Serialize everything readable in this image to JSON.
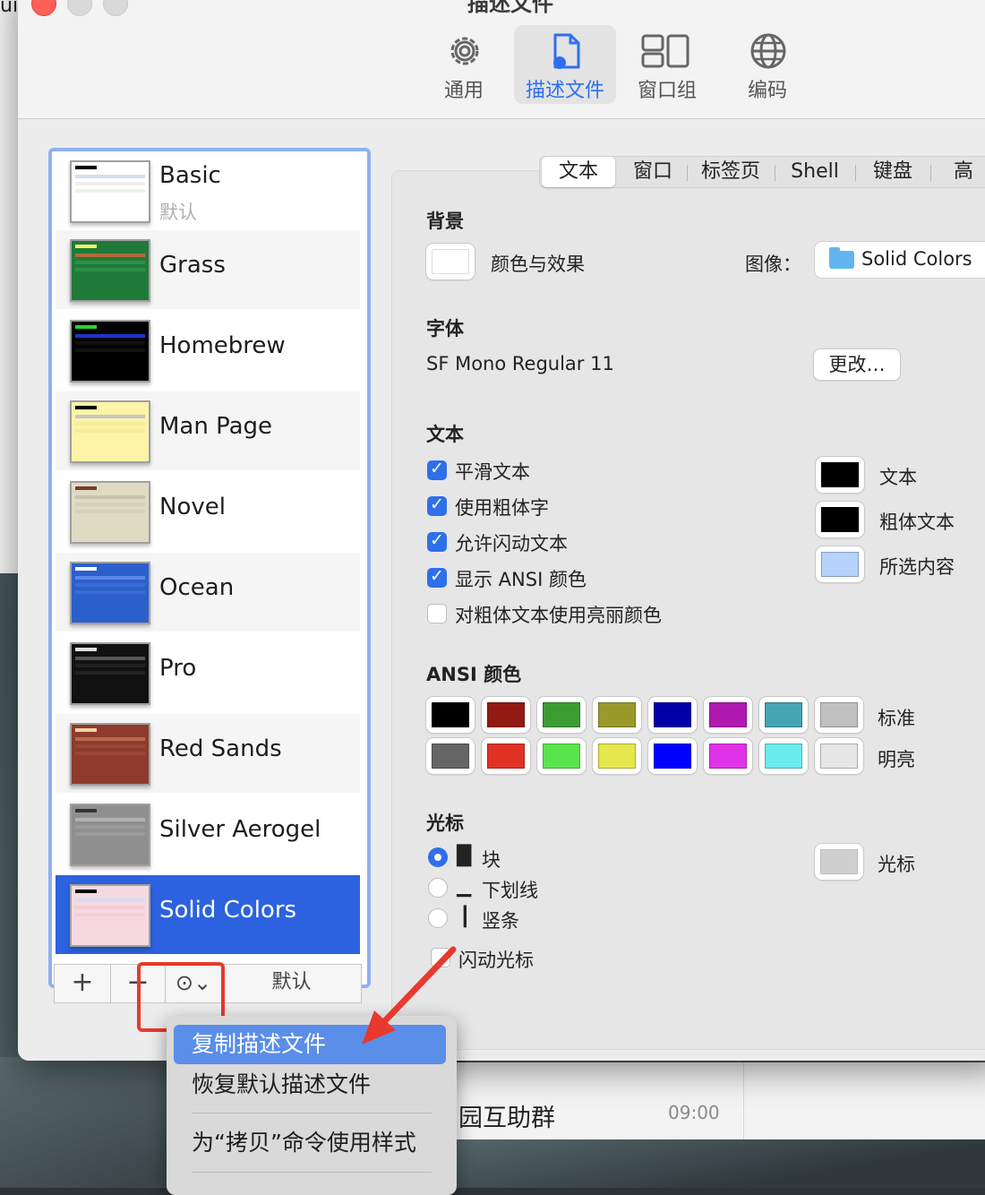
{
  "window": {
    "title": "描述文件"
  },
  "toolbar": {
    "items": [
      {
        "label": "通用",
        "icon": "gear-icon"
      },
      {
        "label": "描述文件",
        "icon": "profile-document-icon"
      },
      {
        "label": "窗口组",
        "icon": "window-groups-icon"
      },
      {
        "label": "编码",
        "icon": "globe-icon"
      }
    ],
    "active_index": 1
  },
  "profiles": [
    {
      "name": "Basic",
      "subtitle": "默认"
    },
    {
      "name": "Grass"
    },
    {
      "name": "Homebrew"
    },
    {
      "name": "Man Page"
    },
    {
      "name": "Novel"
    },
    {
      "name": "Ocean"
    },
    {
      "name": "Pro"
    },
    {
      "name": "Red Sands"
    },
    {
      "name": "Silver Aerogel"
    },
    {
      "name": "Solid Colors"
    }
  ],
  "selected_profile": "Solid Colors",
  "list_buttons": {
    "add": "+",
    "remove": "−",
    "more": "⊙⌄",
    "default": "默认"
  },
  "tabs": [
    "文本",
    "窗口",
    "标签页",
    "Shell",
    "键盘",
    "高"
  ],
  "active_tab": "文本",
  "background": {
    "heading": "背景",
    "color_effects_label": "颜色与效果",
    "image_label": "图像：",
    "image_value": "Solid Colors"
  },
  "font": {
    "heading": "字体",
    "value": "SF Mono Regular 11",
    "change_button": "更改…"
  },
  "text": {
    "heading": "文本",
    "checkboxes": [
      {
        "label": "平滑文本",
        "checked": true
      },
      {
        "label": "使用粗体字",
        "checked": true
      },
      {
        "label": "允许闪动文本",
        "checked": true
      },
      {
        "label": "显示 ANSI 颜色",
        "checked": true
      },
      {
        "label": "对粗体文本使用亮丽颜色",
        "checked": false
      }
    ],
    "color_labels": {
      "text": "文本",
      "bold": "粗体文本",
      "selection": "所选内容"
    },
    "colors": {
      "text": "#000000",
      "bold": "#000000",
      "selection": "#b5d3fb"
    }
  },
  "ansi": {
    "heading": "ANSI 颜色",
    "normal_label": "标准",
    "bright_label": "明亮",
    "normal": [
      "#000000",
      "#931a12",
      "#3b9d31",
      "#999a2b",
      "#0000a8",
      "#b01ab1",
      "#46a5b3",
      "#c0c0c0"
    ],
    "bright": [
      "#666666",
      "#e03225",
      "#5ae44b",
      "#e6e64d",
      "#0000ff",
      "#e033e8",
      "#6aebec",
      "#e6e6e6"
    ]
  },
  "cursor": {
    "heading": "光标",
    "options": [
      {
        "glyph": "█",
        "label": "块",
        "selected": true
      },
      {
        "glyph": "▁",
        "label": "下划线",
        "selected": false
      },
      {
        "glyph": "┃",
        "label": "竖条",
        "selected": false
      }
    ],
    "blink_label": "闪动光标",
    "color_label": "光标",
    "color": "#cfcfcf"
  },
  "menu": {
    "items": [
      "复制描述文件",
      "恢复默认描述文件",
      "为“拷贝”命令使用样式"
    ],
    "highlighted": 0
  },
  "background_chat": {
    "name": "园互助群",
    "time": "09:00"
  },
  "desktop_corner_text": "ui"
}
